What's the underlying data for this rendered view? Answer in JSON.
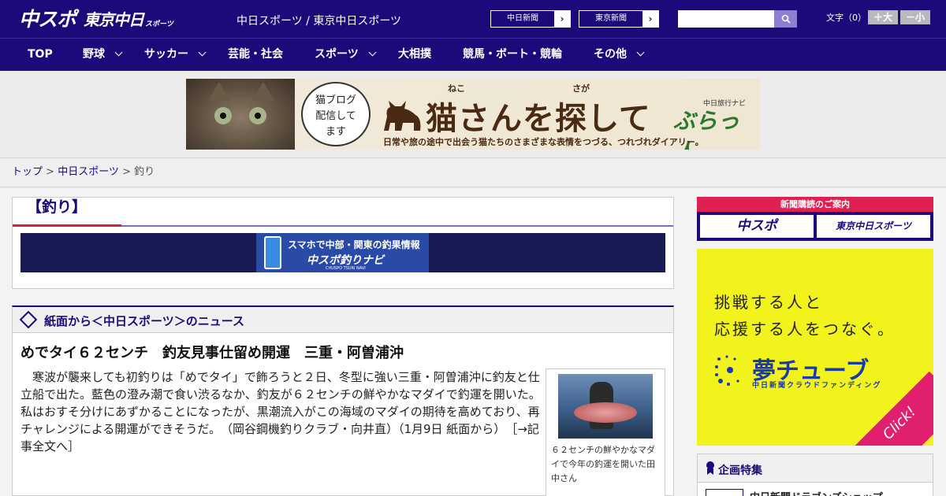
{
  "header": {
    "logo_main": "中スポ",
    "logo_sub": "東京中日",
    "logo_sub_small": "スポーツ",
    "site_title": "中日スポーツ / 東京中日スポーツ",
    "paper_links": [
      {
        "label": "中日新聞",
        "arrow": "›"
      },
      {
        "label": "東京新聞",
        "arrow": "›"
      }
    ],
    "search_placeholder": "",
    "font_size_label": "文字（0）",
    "font_larger": "＋大",
    "font_smaller": "－小"
  },
  "nav": {
    "items": [
      {
        "label": "TOP",
        "has_dropdown": false
      },
      {
        "label": "野球",
        "has_dropdown": true
      },
      {
        "label": "サッカー",
        "has_dropdown": true
      },
      {
        "label": "芸能・社会",
        "has_dropdown": false
      },
      {
        "label": "スポーツ",
        "has_dropdown": true
      },
      {
        "label": "大相撲",
        "has_dropdown": false
      },
      {
        "label": "競馬・ボート・競輪",
        "has_dropdown": false
      },
      {
        "label": "その他",
        "has_dropdown": true
      }
    ]
  },
  "banner": {
    "bubble_text": "猫ブログ\n配信して\nます",
    "title": "猫さんを探して",
    "ruby_neko": "ねこ",
    "ruby_saga": "さが",
    "brand_small": "中日旅行ナビ",
    "brand": "ぶらっ人",
    "subtitle": "日常や旅の途中で出会う猫たちのさまざまな表情をつづる、つれづれダイアリー。"
  },
  "breadcrumb": {
    "items": [
      {
        "label": "トップ",
        "link": true
      },
      {
        "label": "中日スポーツ",
        "link": true
      },
      {
        "label": "釣り",
        "link": false
      }
    ],
    "separator": " > "
  },
  "category": {
    "title": "【釣り】",
    "promo_line1": "スマホで中部・関東の釣果情報",
    "promo_line2": "中スポ釣りナビ",
    "promo_line3": "CHUSPO TSURI NAVI"
  },
  "news": {
    "section_title": "紙面から＜中日スポーツ＞のニュース",
    "article_title": "めでタイ６２センチ　釣友見事仕留め開運　三重・阿曽浦沖",
    "article_body": "　寒波が襲来しても初釣りは「めでタイ」で飾ろうと２日、冬型に強い三重・阿曽浦沖に釣友と仕立船で出た。藍色の澄み潮で食い渋るなか、釣友が６２センチの鮮やかなマダイで釣運を開いた。私はおすそ分けにあずかることになったが、黒潮流入がこの海域のマダイの期待を高めており、再チャレンジによる開運ができそうだ。　（岡谷鋼機釣りクラブ・向井直）（1月9日 紙面から）",
    "read_more": "［→記事全文へ］",
    "photo_caption": "６２センチの鮮やかなマダイで今年の釣運を開いた田中さん"
  },
  "sidebar": {
    "subscription_head": "新聞購読のご案内",
    "subscription_btn1": "中スポ",
    "subscription_btn2": "東京中日スポーツ",
    "yume_line1": "挑戦する人と",
    "yume_line2": "応援する人をつなぐ。",
    "yume_logo": "夢チューブ",
    "yume_sub": "中日新聞クラウドファンディング",
    "yume_click": "Click!",
    "special_title": "企画特集",
    "special_item": "中日新聞ドラゴンズショップ"
  },
  "colors": {
    "brand_navy": "#1c0a7a",
    "accent_red": "#e02050",
    "yume_yellow": "#f2f31c"
  }
}
